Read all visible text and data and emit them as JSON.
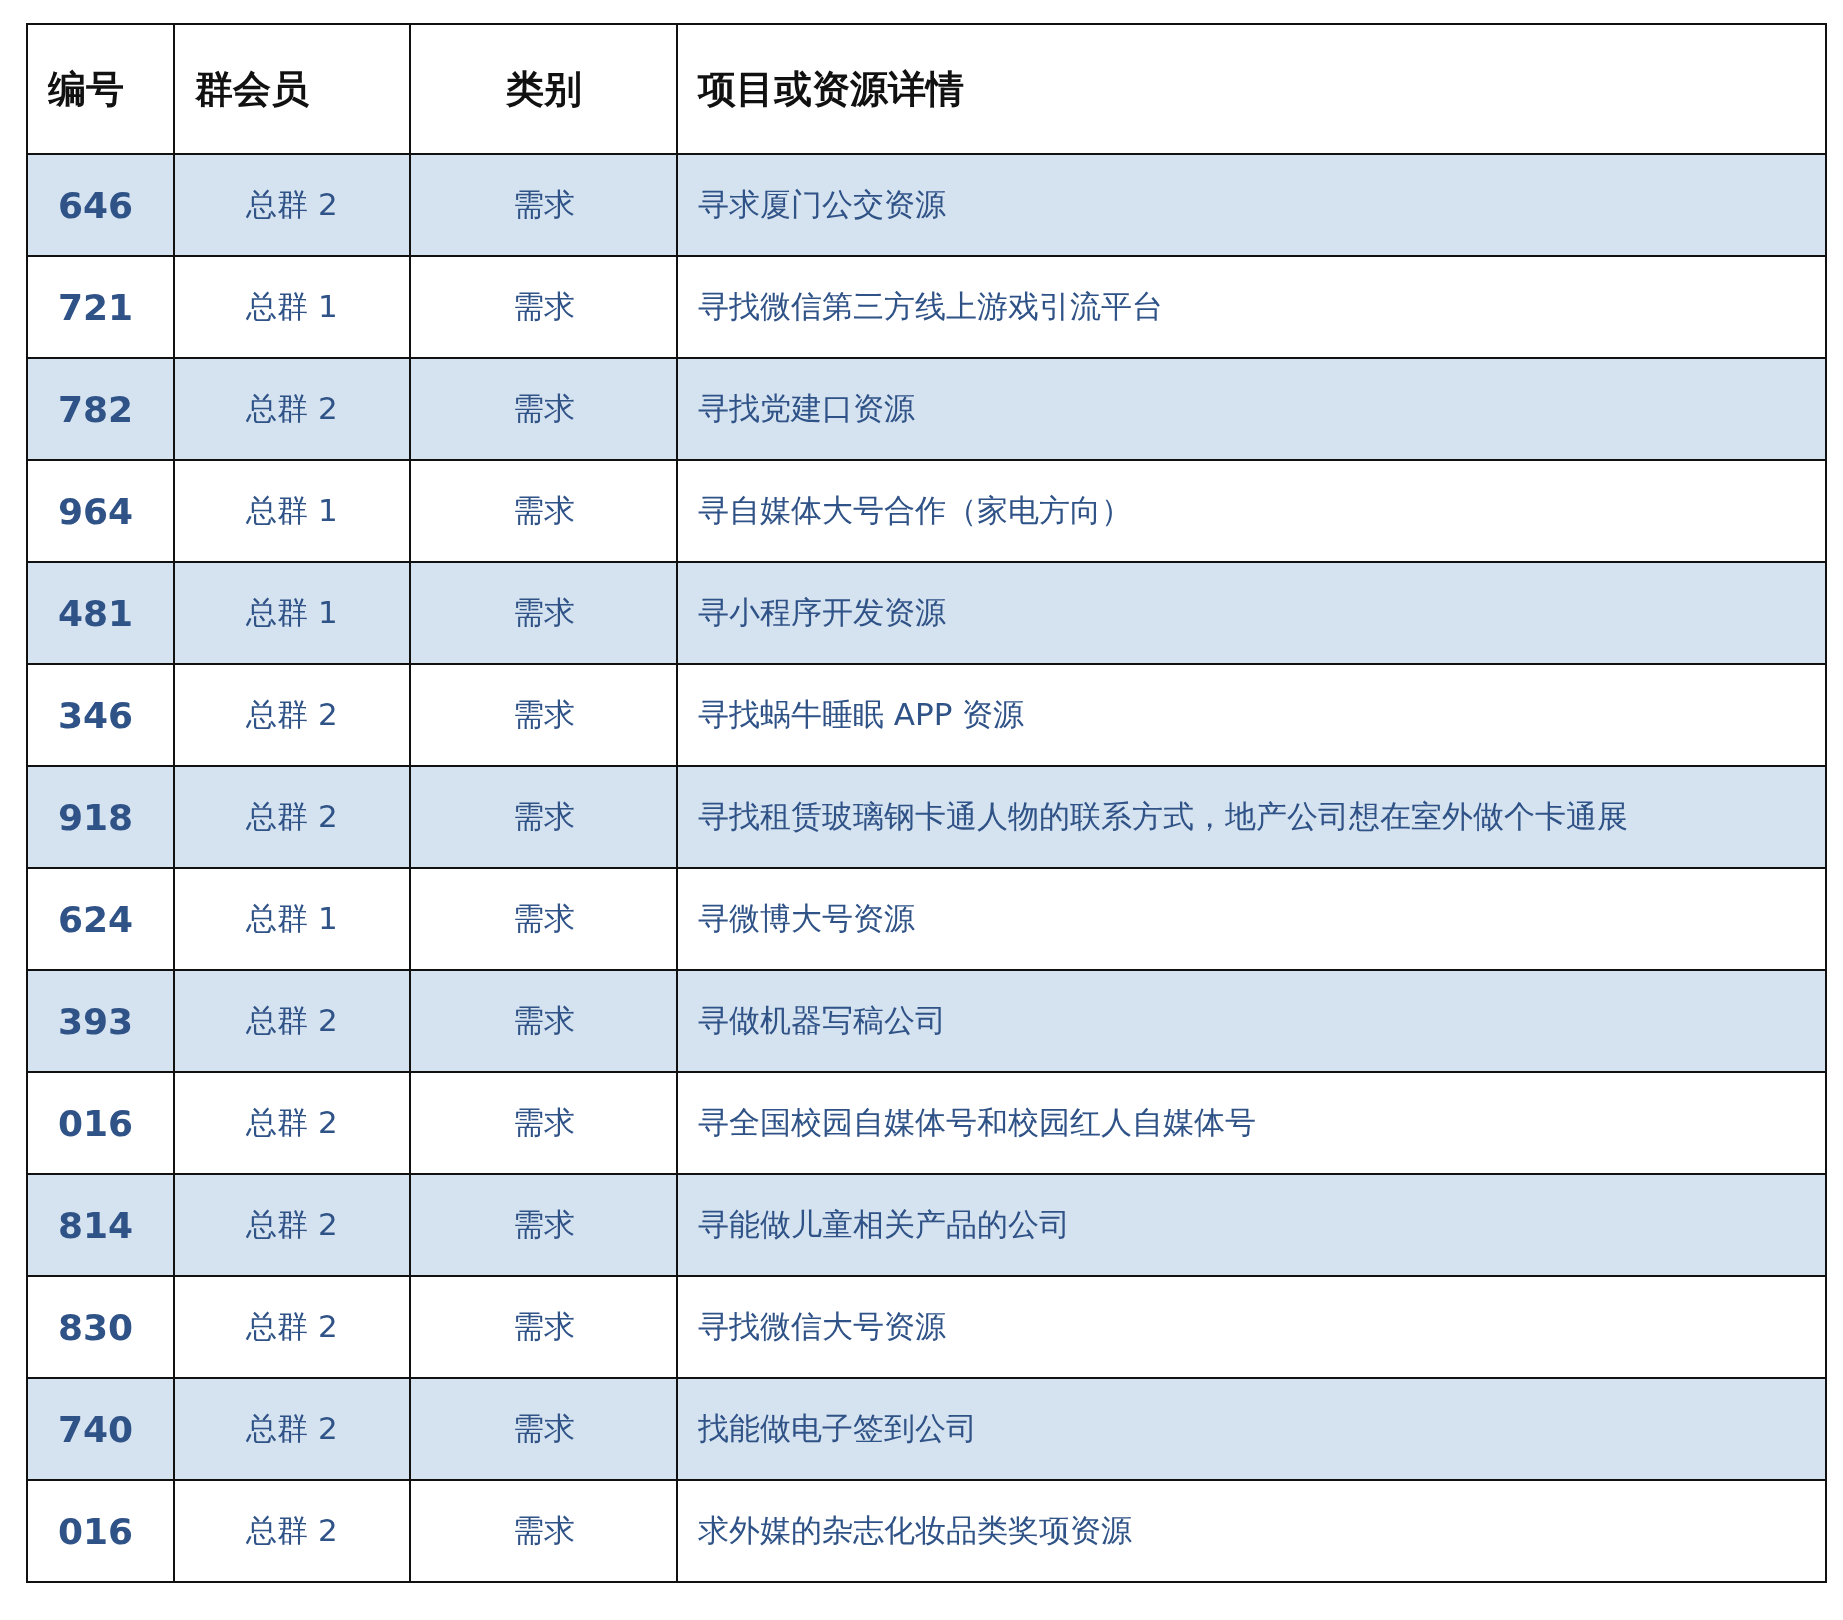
{
  "table": {
    "columns": [
      "编号",
      "群会员",
      "类别",
      "项目或资源详情"
    ],
    "rows": [
      [
        "646",
        "总群 2",
        "需求",
        "寻求厦门公交资源"
      ],
      [
        "721",
        "总群 1",
        "需求",
        "寻找微信第三方线上游戏引流平台"
      ],
      [
        "782",
        "总群 2",
        "需求",
        "寻找党建口资源"
      ],
      [
        "964",
        "总群 1",
        "需求",
        "寻自媒体大号合作（家电方向）"
      ],
      [
        "481",
        "总群 1",
        "需求",
        "寻小程序开发资源"
      ],
      [
        "346",
        "总群 2",
        "需求",
        "寻找蜗牛睡眠 APP 资源"
      ],
      [
        "918",
        "总群 2",
        "需求",
        "寻找租赁玻璃钢卡通人物的联系方式，地产公司想在室外做个卡通展"
      ],
      [
        "624",
        "总群 1",
        "需求",
        "寻微博大号资源"
      ],
      [
        "393",
        "总群 2",
        "需求",
        "寻做机器写稿公司"
      ],
      [
        "016",
        "总群 2",
        "需求",
        "寻全国校园自媒体号和校园红人自媒体号"
      ],
      [
        "814",
        "总群 2",
        "需求",
        "寻能做儿童相关产品的公司"
      ],
      [
        "830",
        "总群 2",
        "需求",
        "寻找微信大号资源"
      ],
      [
        "740",
        "总群 2",
        "需求",
        "找能做电子签到公司"
      ],
      [
        "016",
        "总群 2",
        "需求",
        "求外媒的杂志化妆品类奖项资源"
      ]
    ]
  }
}
